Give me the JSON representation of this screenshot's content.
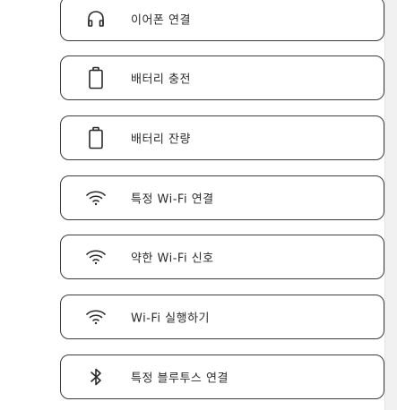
{
  "colors": {
    "text": "#2a2a2a",
    "border": "#3a3a3a",
    "background": "#ffffff"
  },
  "items": [
    {
      "label": "이어폰 연결",
      "icon": "headphones-icon"
    },
    {
      "label": "배터리 충전",
      "icon": "battery-icon"
    },
    {
      "label": "배터리 잔량",
      "icon": "battery-icon"
    },
    {
      "label": "특정 Wi-Fi 연결",
      "icon": "wifi-icon"
    },
    {
      "label": "약한 Wi-Fi 신호",
      "icon": "wifi-icon"
    },
    {
      "label": "Wi-Fi 실행하기",
      "icon": "wifi-icon"
    },
    {
      "label": "특정 블루투스 연결",
      "icon": "bluetooth-icon"
    }
  ]
}
